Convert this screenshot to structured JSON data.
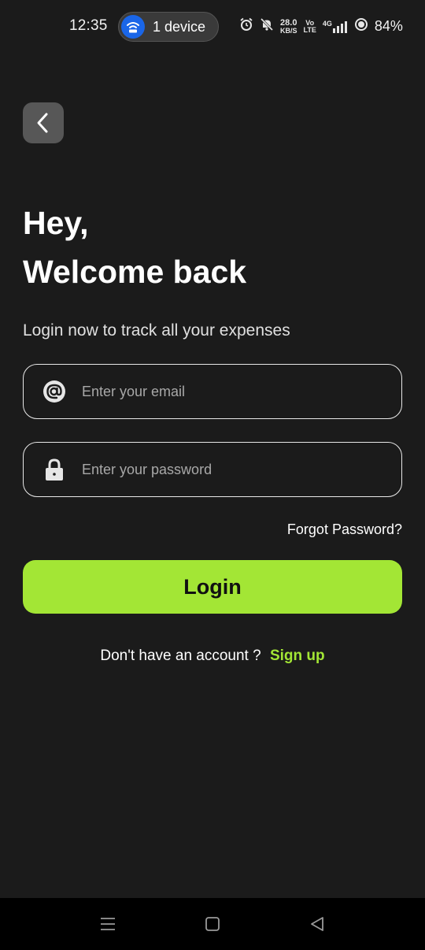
{
  "status_bar": {
    "time": "12:35",
    "hotspot_label": "1 device",
    "net_speed_value": "28.0",
    "net_speed_unit": "KB/S",
    "volte_top": "Vo",
    "volte_bottom": "LTE",
    "network_type": "4G",
    "battery": "84%"
  },
  "header": {
    "greeting_line1": "Hey,",
    "greeting_line2": "Welcome back",
    "subtitle": "Login now to track all your expenses"
  },
  "form": {
    "email_placeholder": "Enter your email",
    "password_placeholder": "Enter your password",
    "forgot_password": "Forgot Password?",
    "login_label": "Login"
  },
  "signup": {
    "prompt": "Don't have an account ?",
    "link": "Sign up"
  },
  "colors": {
    "background": "#1b1b1b",
    "accent": "#a3e635",
    "back_button": "#575757"
  }
}
